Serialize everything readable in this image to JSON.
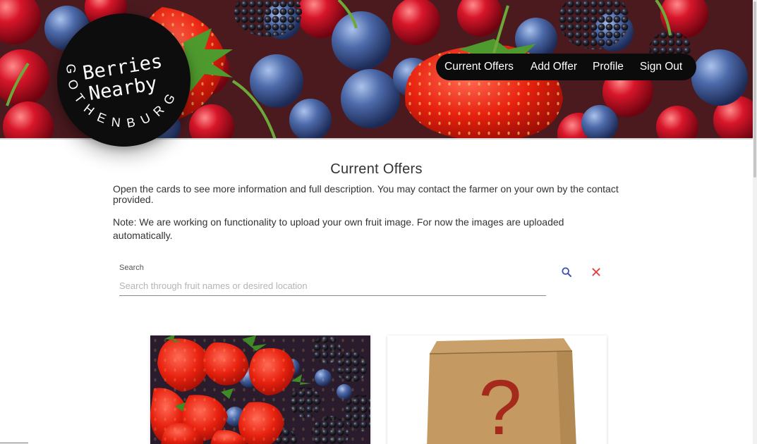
{
  "logo": {
    "line1": "Berries",
    "line2": "Nearby",
    "city": "GOTHENBURG"
  },
  "nav": {
    "items": [
      {
        "label": "Current Offers"
      },
      {
        "label": "Add Offer"
      },
      {
        "label": "Profile"
      },
      {
        "label": "Sign Out"
      }
    ]
  },
  "main": {
    "title": "Current Offers",
    "intro": "Open the cards to see more information and full description. You may contact the farmer on your own by the contact provided.",
    "note": "Note: We are working on functionality to upload your own fruit image. For now the images are uploaded automatically."
  },
  "search": {
    "label": "Search",
    "placeholder": "Search through fruit names or desired location",
    "value": "",
    "search_icon": "search-icon",
    "clear_icon": "close-icon",
    "search_color": "#3f51b5",
    "clear_color": "#e53935"
  },
  "cards": [
    {
      "image": "mixed-berries-photo"
    },
    {
      "image": "mystery-box-question-mark",
      "symbol": "?"
    }
  ],
  "colors": {
    "nav_bg": "#0b0b0b",
    "logo_bg": "#0d0d0d",
    "text": "#333333"
  }
}
